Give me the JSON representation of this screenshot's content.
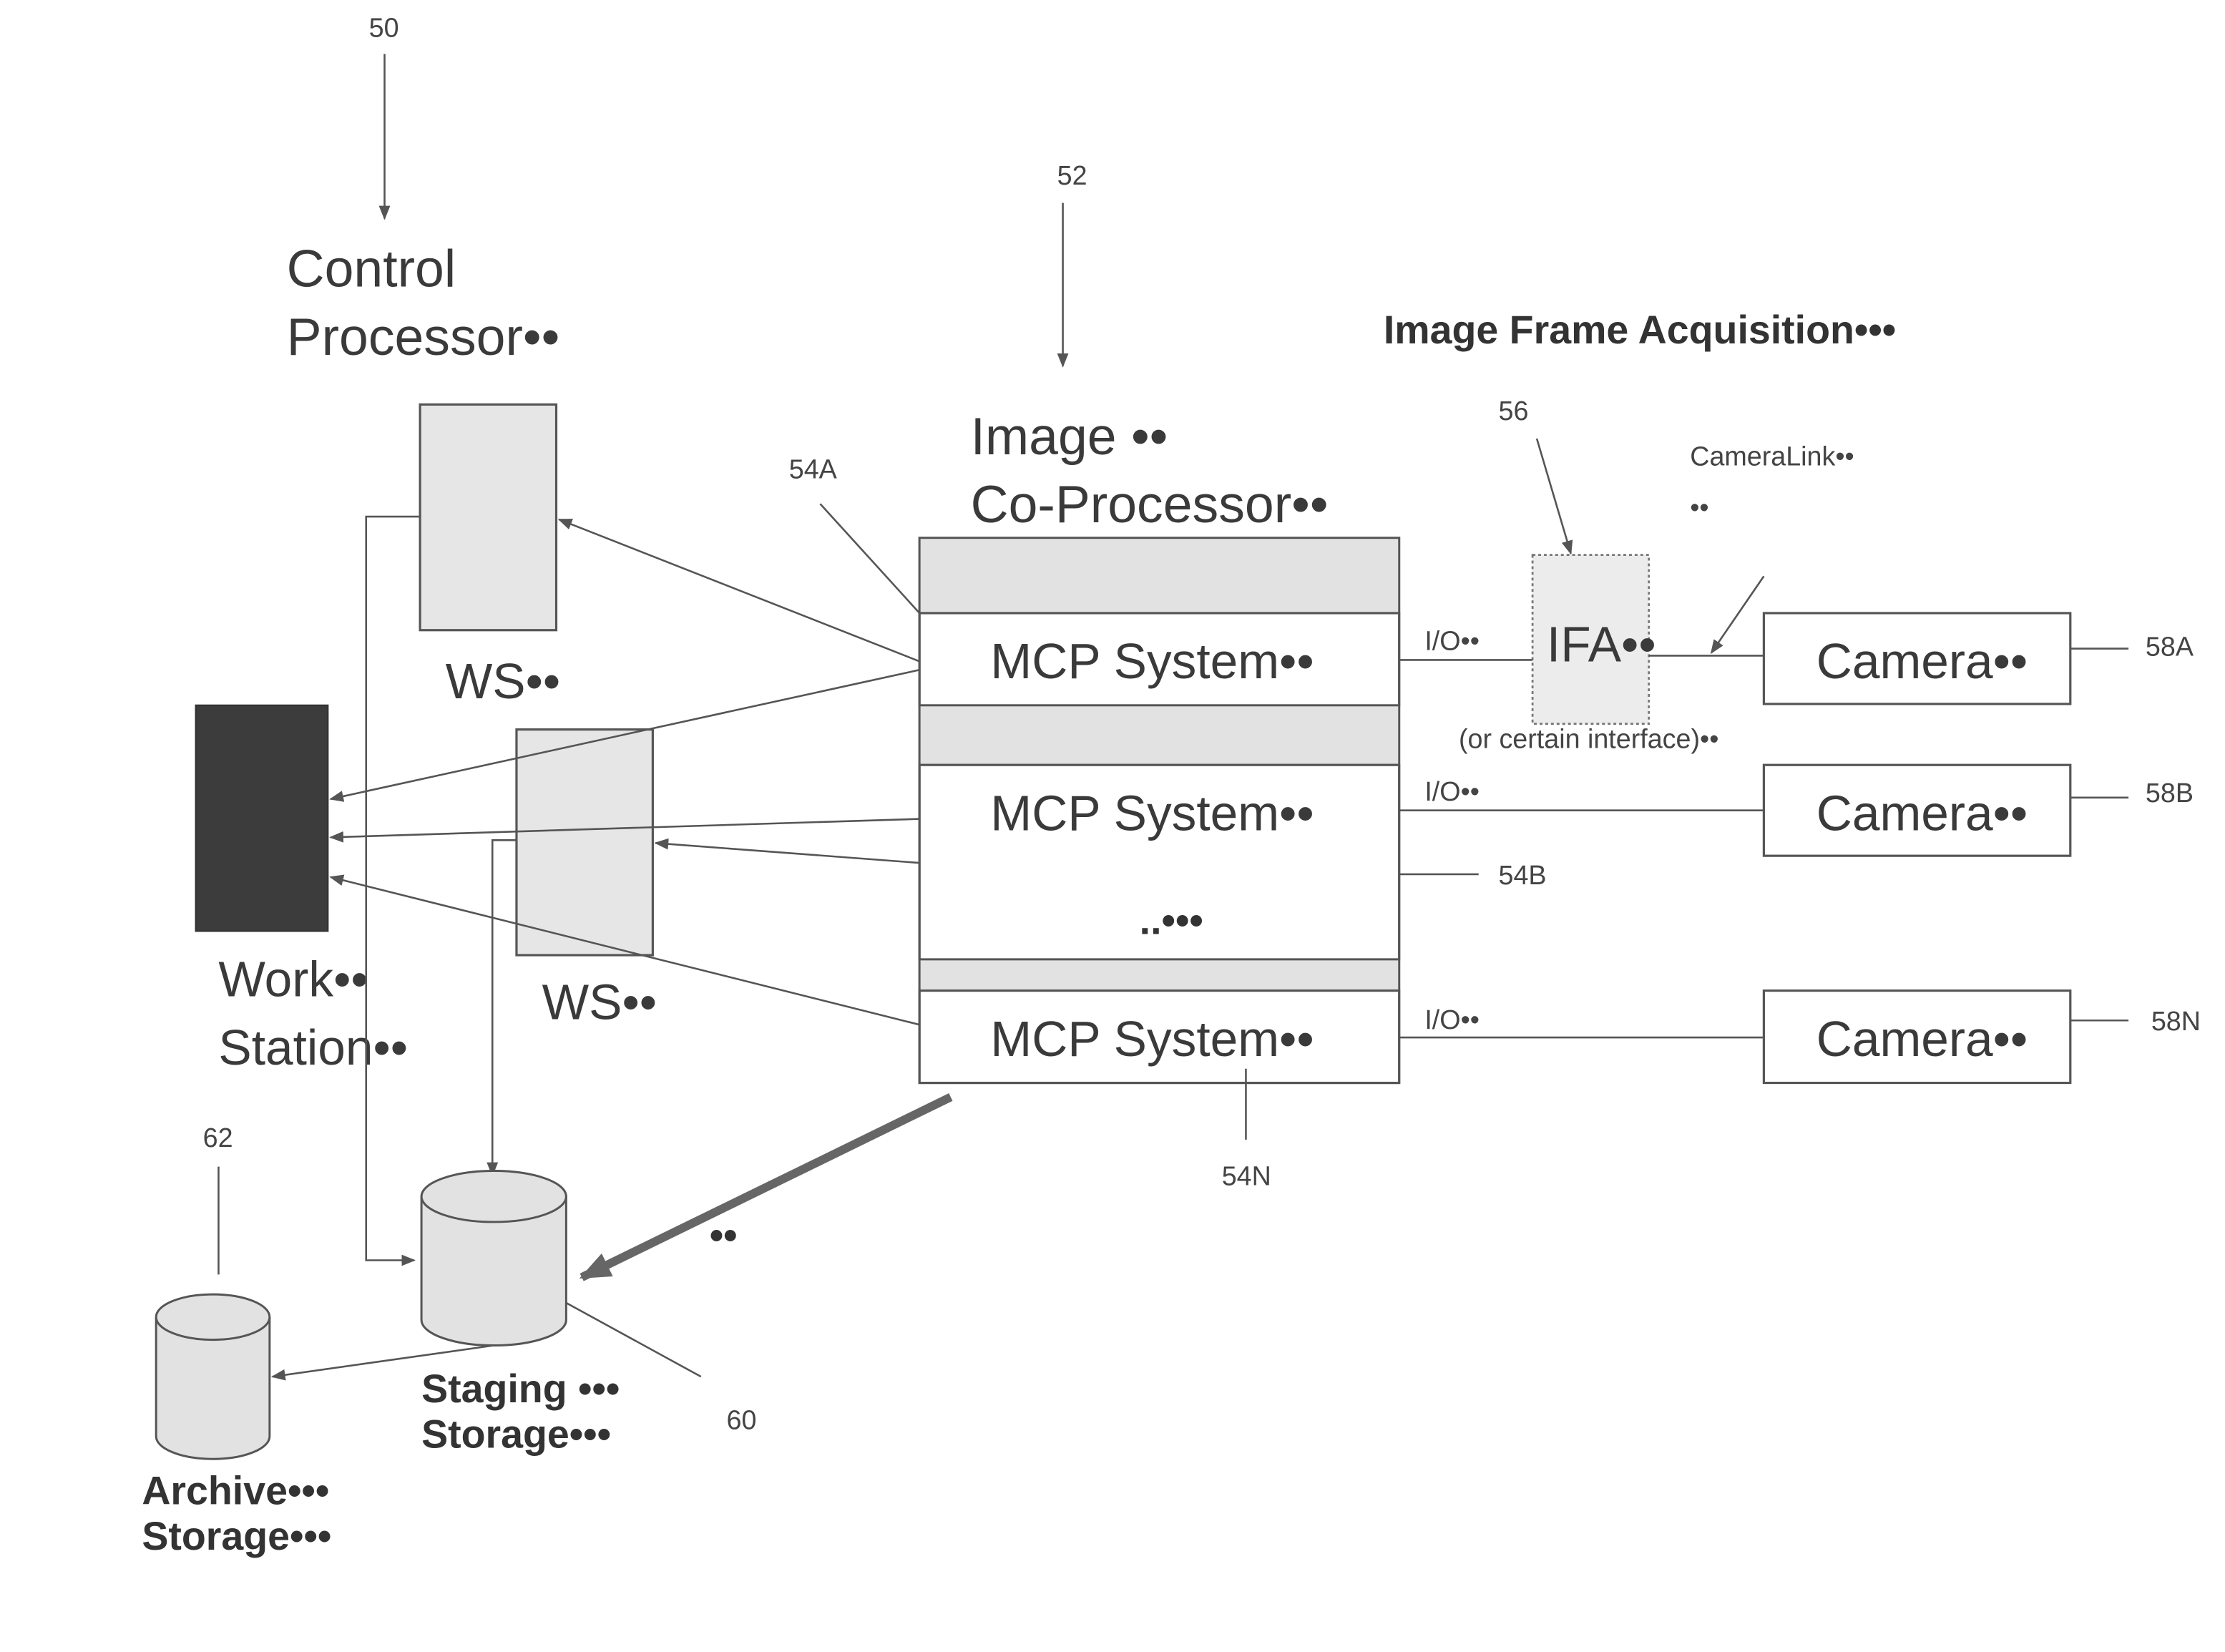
{
  "labels": {
    "control_processor_line1": "Control",
    "control_processor_line2": "Processor••",
    "image_coprocessor_line1": "Image ••",
    "image_coprocessor_line2": "Co-Processor••",
    "image_frame_acquisition": "Image Frame Acquisition•••",
    "camera_link": "CameraLink••",
    "camera_link_dots": "••",
    "ws_top": "WS••",
    "ws_middle": "WS••",
    "work_station_line1": "Work••",
    "work_station_line2": "Station••",
    "mcp_system_a": "MCP System••",
    "mcp_system_b": "MCP System••",
    "mcp_system_n": "MCP System••",
    "mcp_ellipsis": "..•••",
    "ifa": "IFA••",
    "ifa_note": "(or certain interface)••",
    "io_a": "I/O••",
    "io_b": "I/O••",
    "io_n": "I/O••",
    "camera_a": "Camera••",
    "camera_b": "Camera••",
    "camera_n": "Camera••",
    "staging_line1": "Staging •••",
    "staging_line2": "Storage•••",
    "archive_line1": "Archive•••",
    "archive_line2": "Storage•••",
    "thick_arrow_dots": "••"
  },
  "refs": {
    "r50": "50",
    "r52": "52",
    "r54a": "54A",
    "r54b": "54B",
    "r54n": "54N",
    "r56": "56",
    "r58a": "58A",
    "r58b": "58B",
    "r58n": "58N",
    "r60": "60",
    "r62": "62"
  }
}
